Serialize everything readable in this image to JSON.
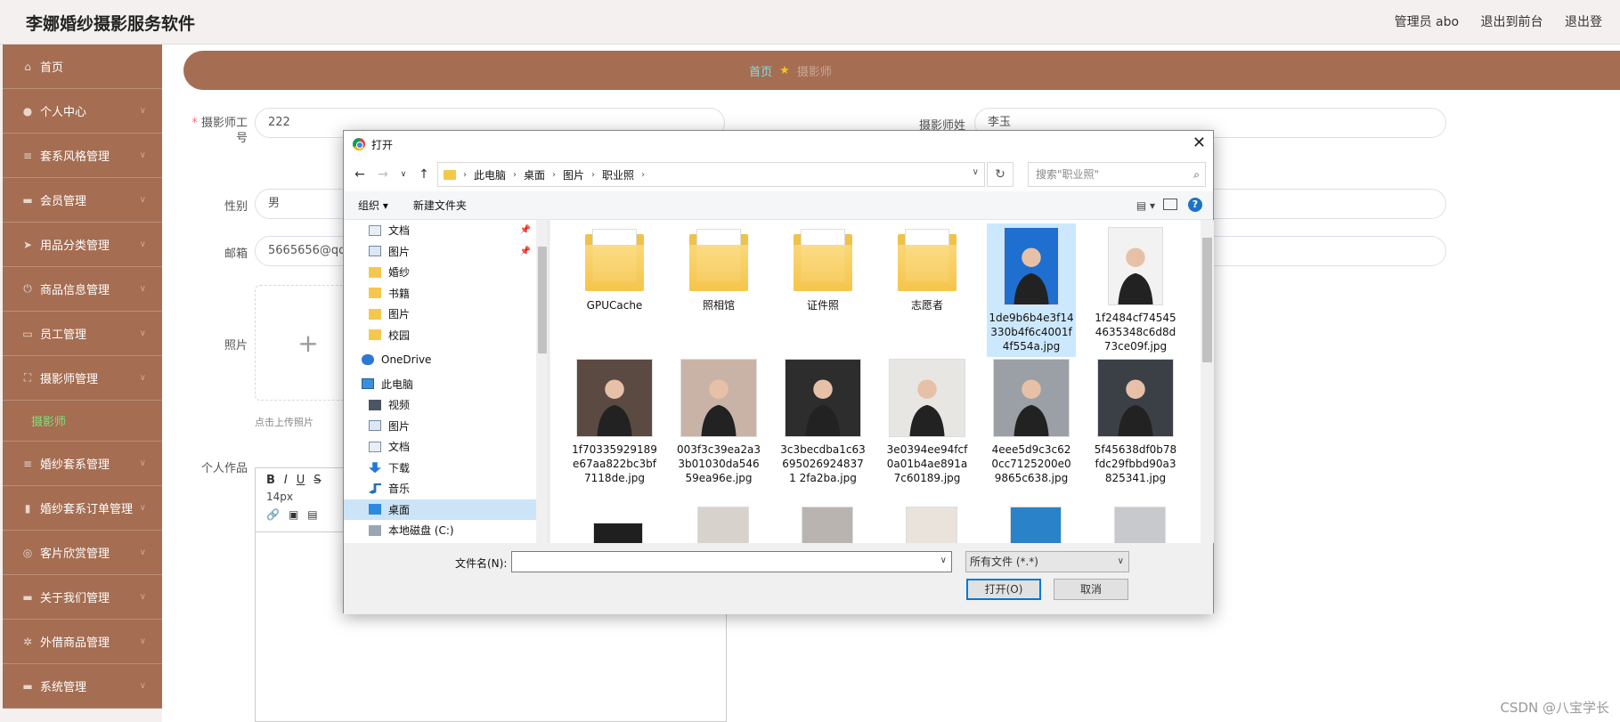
{
  "app": {
    "title": "李娜婚纱摄影服务软件"
  },
  "top": {
    "admin": "管理员 abo",
    "to_front": "退出到前台",
    "logout": "退出登"
  },
  "sidebar": {
    "items": [
      {
        "label": "首页",
        "icon": "home-icon"
      },
      {
        "label": "个人中心",
        "icon": "user-icon"
      },
      {
        "label": "套系风格管理",
        "icon": "list-icon"
      },
      {
        "label": "会员管理",
        "icon": "monitor-icon"
      },
      {
        "label": "用品分类管理",
        "icon": "send-icon"
      },
      {
        "label": "商品信息管理",
        "icon": "power-icon"
      },
      {
        "label": "员工管理",
        "icon": "card-icon"
      },
      {
        "label": "摄影师管理",
        "icon": "frame-icon"
      },
      {
        "label": "婚纱套系管理",
        "icon": "list-icon"
      },
      {
        "label": "婚纱套系订单管理",
        "icon": "chart-icon"
      },
      {
        "label": "客片欣赏管理",
        "icon": "compass-icon"
      },
      {
        "label": "关于我们管理",
        "icon": "monitor-icon"
      },
      {
        "label": "外借商品管理",
        "icon": "gear-icon"
      },
      {
        "label": "系统管理",
        "icon": "monitor-icon"
      }
    ],
    "submenu": "摄影师"
  },
  "breadcrumb": {
    "home": "首页",
    "current": "摄影师"
  },
  "form": {
    "id_label": "摄影师工号",
    "id_value": "222",
    "name_label": "摄影师姓",
    "name_value": "李玉",
    "gender_label": "性别",
    "gender_value": "男",
    "email_label": "邮箱",
    "email_value": "5665656@qq.c",
    "photo_label": "照片",
    "upload_hint": "点击上传照片",
    "works_label": "个人作品",
    "editor_font_size": "14px"
  },
  "dialog": {
    "title": "打开",
    "path": [
      "此电脑",
      "桌面",
      "图片",
      "职业照"
    ],
    "search_placeholder": "搜索\"职业照\"",
    "organize": "组织 ▾",
    "new_folder": "新建文件夹",
    "nav_items": [
      {
        "label": "文档",
        "icon": "doc",
        "indent": 1,
        "pinned": true
      },
      {
        "label": "图片",
        "icon": "pic",
        "indent": 1,
        "pinned": true
      },
      {
        "label": "婚纱",
        "icon": "fold",
        "indent": 1
      },
      {
        "label": "书籍",
        "icon": "fold",
        "indent": 1
      },
      {
        "label": "图片",
        "icon": "fold",
        "indent": 1
      },
      {
        "label": "校园",
        "icon": "fold",
        "indent": 1
      },
      {
        "label": "OneDrive",
        "icon": "cloud",
        "indent": 0,
        "gap": true
      },
      {
        "label": "此电脑",
        "icon": "pc",
        "indent": 0,
        "gap": true
      },
      {
        "label": "视频",
        "icon": "vid",
        "indent": 1
      },
      {
        "label": "图片",
        "icon": "pic",
        "indent": 1
      },
      {
        "label": "文档",
        "icon": "doc",
        "indent": 1
      },
      {
        "label": "下载",
        "icon": "dl",
        "indent": 1
      },
      {
        "label": "音乐",
        "icon": "mus",
        "indent": 1
      },
      {
        "label": "桌面",
        "icon": "desk",
        "indent": 1,
        "selected": true
      },
      {
        "label": "本地磁盘 (C:)",
        "icon": "drive",
        "indent": 1
      }
    ],
    "files": [
      {
        "name": "GPUCache",
        "kind": "folder"
      },
      {
        "name": "照相馆",
        "kind": "folder"
      },
      {
        "name": "证件照",
        "kind": "folder"
      },
      {
        "name": "志愿者",
        "kind": "folder"
      },
      {
        "name": "1de9b6b4e3f14330b4f6c4001f4f554a.jpg",
        "kind": "photo",
        "bg": "#1e6fd0",
        "selected": true
      },
      {
        "name": "1f2484cf745454635348c6d8d73ce09f.jpg",
        "kind": "photo",
        "bg": "#f2f2f2"
      },
      {
        "name": "1f70335929189e67aa822bc3bf7118de.jpg",
        "kind": "photo",
        "bg": "#5b4a42"
      },
      {
        "name": "003f3c39ea2a33b01030da54659ea96e.jpg",
        "kind": "photo",
        "bg": "#c9b3a6"
      },
      {
        "name": "3c3becdba1c636950269248371 2fa2ba.jpg",
        "kind": "photo",
        "bg": "#2d2d2d"
      },
      {
        "name": "3e0394ee94fcf0a01b4ae891a7c60189.jpg",
        "kind": "photo",
        "bg": "#e8e6e3"
      },
      {
        "name": "4eee5d9c3c620cc7125200e09865c638.jpg",
        "kind": "photo",
        "bg": "#9aa0a6"
      },
      {
        "name": "5f45638df0b78fdc29fbbd90a3825341.jpg",
        "kind": "photo",
        "bg": "#3b3f46"
      }
    ],
    "filename_label": "文件名(N):",
    "filetype": "所有文件 (*.*)",
    "open_btn": "打开(O)",
    "cancel_btn": "取消"
  },
  "watermark": "CSDN @八宝学长"
}
